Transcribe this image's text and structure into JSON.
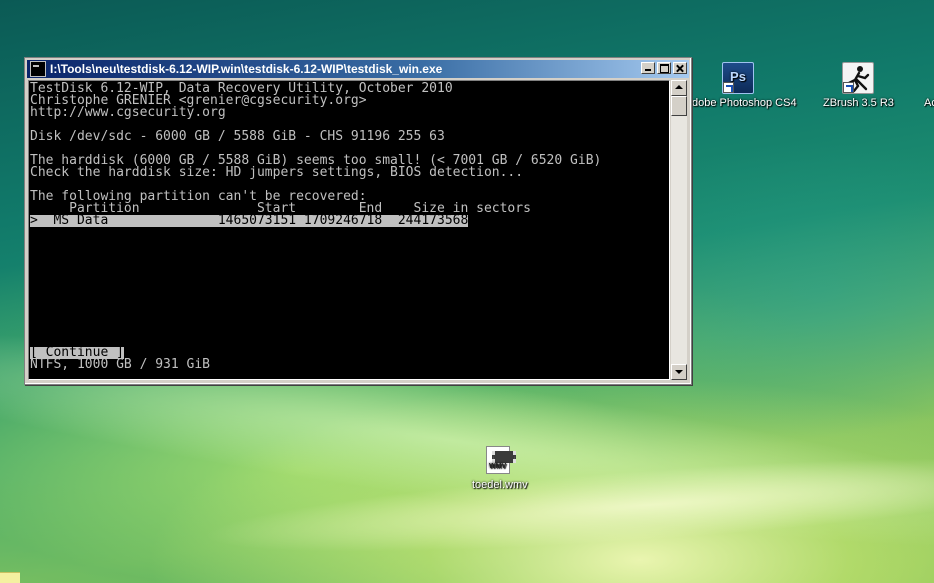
{
  "window": {
    "title": "I:\\Tools\\neu\\testdisk-6.12-WIP.win\\testdisk-6.12-WIP\\testdisk_win.exe",
    "buttons": [
      "minimize",
      "maximize",
      "close"
    ]
  },
  "console": {
    "lines": [
      "TestDisk 6.12-WIP, Data Recovery Utility, October 2010",
      "Christophe GRENIER <grenier@cgsecurity.org>",
      "http://www.cgsecurity.org",
      "",
      "Disk /dev/sdc - 6000 GB / 5588 GiB - CHS 91196 255 63",
      "",
      "The harddisk (6000 GB / 5588 GiB) seems too small! (< 7001 GB / 6520 GiB)",
      "Check the harddisk size: HD jumpers settings, BIOS detection...",
      "",
      "The following partition can't be recovered:",
      "     Partition               Start        End    Size in sectors"
    ],
    "selected_row": ">  MS Data              1465073151 1709246718  244173568",
    "continue_button": "[ Continue ]",
    "footer": "NTFS, 1000 GB / 931 GiB"
  },
  "desktop": {
    "icons": [
      {
        "label": "dobe Photoshop CS4",
        "icon": "photoshop-icon",
        "glyph": "Ps"
      },
      {
        "label": "ZBrush 3.5 R3",
        "icon": "zbrush-icon"
      },
      {
        "label": "Ac",
        "icon": "truncated-icon"
      },
      {
        "label": "toedel.wmv",
        "icon": "wmv-file-icon",
        "glyph": "WMV"
      }
    ]
  }
}
